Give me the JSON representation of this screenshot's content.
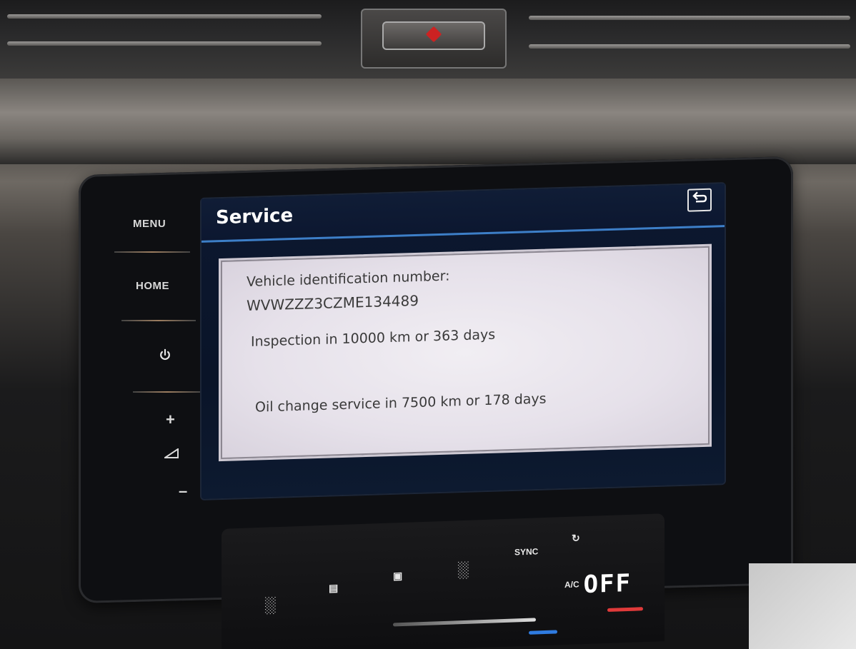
{
  "side_panel": {
    "menu_label": "MENU",
    "home_label": "HOME",
    "power_icon": "power-icon",
    "vol_up_symbol": "+",
    "vol_down_symbol": "–",
    "volume_icon": "volume-icon"
  },
  "screen": {
    "title": "Service",
    "back_icon": "back-icon",
    "vin_label": "Vehicle identification number:",
    "vin_value": "WVWZZZ3CZME134489",
    "inspection_text": "Inspection in 10000 km or 363 days",
    "oil_change_text": "Oil change service in 7500 km or 178 days"
  },
  "climate": {
    "sync_label": "SYNC",
    "ac_label": "A/C",
    "fan_display": "OFF",
    "colors": {
      "heat": "#e03a3a",
      "cool": "#2f7be0",
      "accent": "#3d7fc8"
    }
  }
}
